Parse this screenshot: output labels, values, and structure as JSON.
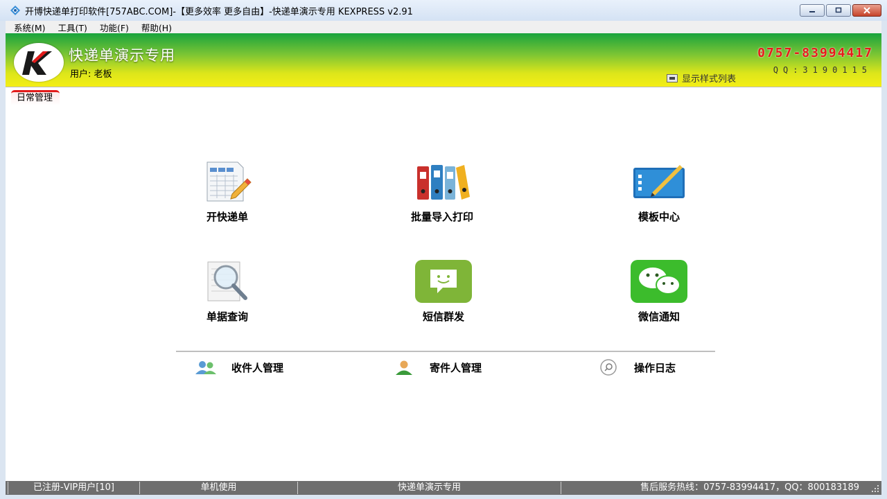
{
  "window": {
    "title": "开博快递单打印软件[757ABC.COM]-【更多效率 更多自由】-快递单演示专用   KEXPRESS v2.91"
  },
  "menu": {
    "items": [
      "系统(M)",
      "工具(T)",
      "功能(F)",
      "帮助(H)"
    ]
  },
  "header": {
    "title": "快递单演示专用",
    "user": "用户: 老板",
    "hotline": "0757-83994417",
    "qq": "QQ:3190115",
    "style_toggle_label": "显示样式列表"
  },
  "tab": {
    "label": "日常管理"
  },
  "tiles": [
    {
      "label": "开快递单",
      "icon": "express-form-icon"
    },
    {
      "label": "批量导入打印",
      "icon": "binders-icon"
    },
    {
      "label": "模板中心",
      "icon": "template-icon"
    },
    {
      "label": "单据查询",
      "icon": "magnifier-icon"
    },
    {
      "label": "短信群发",
      "icon": "sms-icon"
    },
    {
      "label": "微信通知",
      "icon": "wechat-icon"
    }
  ],
  "links": [
    {
      "label": "收件人管理",
      "icon": "recipients-icon"
    },
    {
      "label": "寄件人管理",
      "icon": "sender-icon"
    },
    {
      "label": "操作日志",
      "icon": "search-log-icon"
    }
  ],
  "status": {
    "registered": "已注册-VIP用户[10]",
    "mode": "单机使用",
    "profile": "快递单演示专用",
    "service": "售后服务热线：0757-83994417，QQ：800183189"
  },
  "colors": {
    "accent_red": "#e81a1a",
    "banner_top": "#19a33d",
    "banner_bottom": "#f4ee16"
  }
}
